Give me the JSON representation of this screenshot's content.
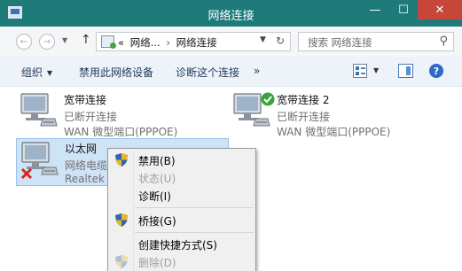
{
  "window": {
    "title": "网络连接",
    "minimize": "—",
    "maximize": "☐",
    "close": "✕"
  },
  "address_bar": {
    "back": "←",
    "forward": "→",
    "up": "↑",
    "chevron": "«",
    "crumbs": [
      "网络...",
      "网络连接"
    ],
    "refresh": "↻",
    "search_placeholder": "搜索 网络连接",
    "search_icon": "search-icon"
  },
  "command_bar": {
    "organize": "组织",
    "disable_device": "禁用此网络设备",
    "diagnose": "诊断这个连接",
    "more": "»",
    "help": "?"
  },
  "connections": [
    {
      "name": "宽带连接",
      "status": "已断开连接",
      "device": "WAN 微型端口(PPPOE)",
      "state_icon": "none"
    },
    {
      "name": "宽带连接 2",
      "status": "已断开连接",
      "device": "WAN 微型端口(PPPOE)",
      "state_icon": "green-check"
    },
    {
      "name": "以太网",
      "status": "网络电缆",
      "device": "Realtek P",
      "state_icon": "red-x"
    }
  ],
  "context_menu": {
    "items": [
      {
        "label": "禁用(B)",
        "enabled": true,
        "shield": true
      },
      {
        "label": "状态(U)",
        "enabled": false,
        "shield": false
      },
      {
        "label": "诊断(I)",
        "enabled": true,
        "shield": false
      },
      {
        "label": "桥接(G)",
        "enabled": true,
        "shield": true
      },
      {
        "label": "创建快捷方式(S)",
        "enabled": true,
        "shield": false
      },
      {
        "label": "删除(D)",
        "enabled": false,
        "shield": true
      }
    ]
  },
  "colors": {
    "titlebar": "#1f7a7a",
    "close_button": "#c7463a",
    "selection": "#cfe3f7",
    "link_text": "#1e3956",
    "disabled_text": "#a0a0a0"
  }
}
